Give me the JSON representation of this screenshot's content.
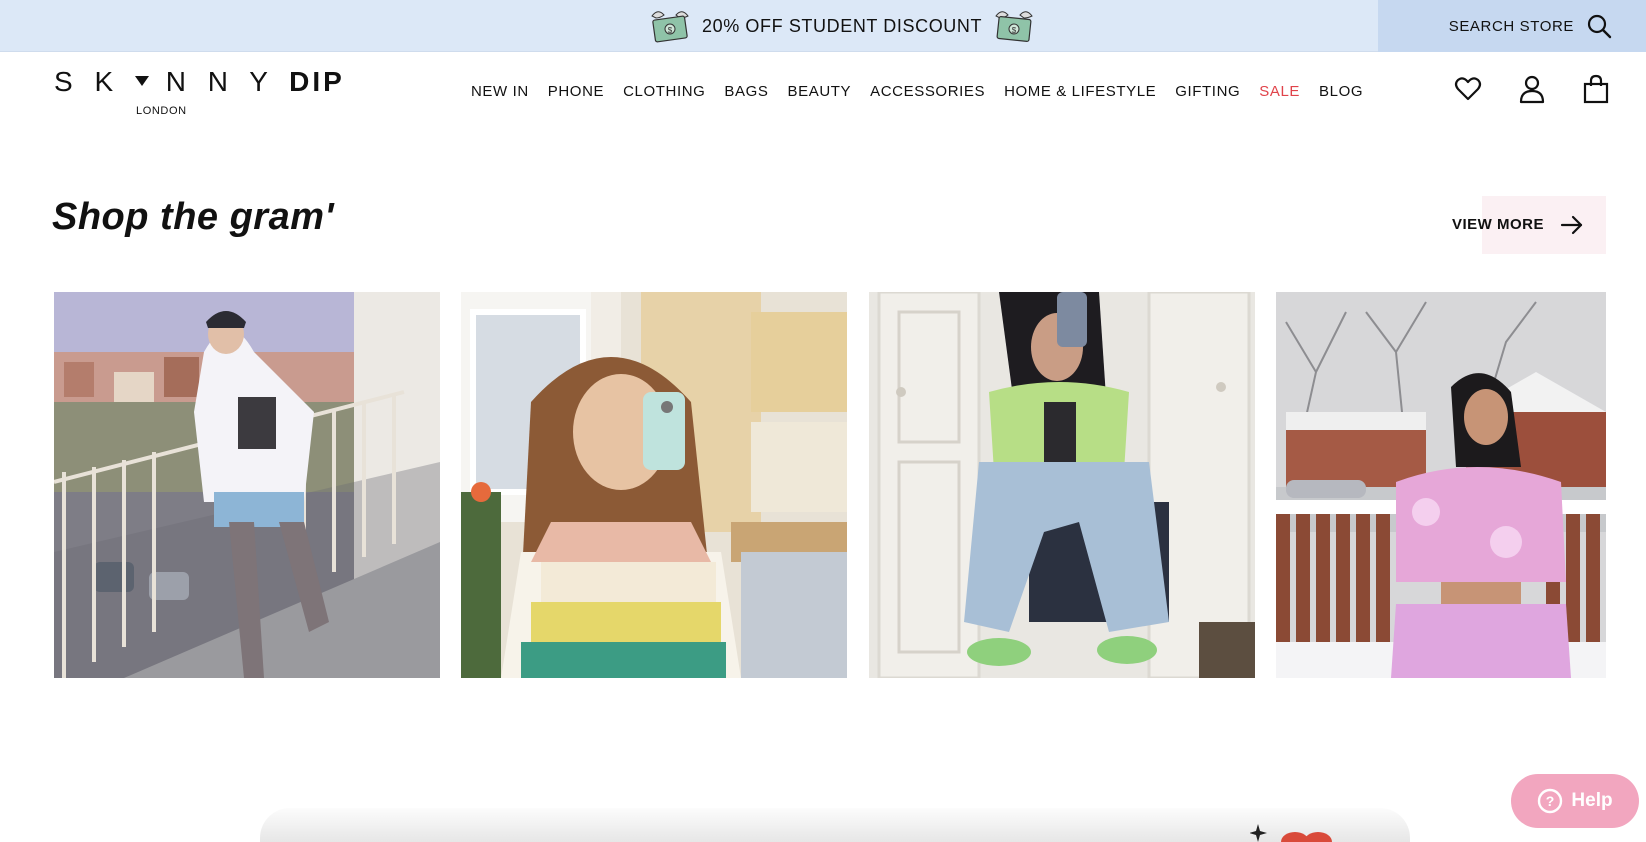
{
  "promo": {
    "text": "20% OFF STUDENT DISCOUNT",
    "icon": "money-with-wings-icon"
  },
  "search": {
    "label": "SEARCH STORE",
    "icon": "search-icon"
  },
  "logo": {
    "text": "SKYNNY DIP",
    "subtext": "LONDON"
  },
  "nav": {
    "items": [
      {
        "label": "NEW IN"
      },
      {
        "label": "PHONE"
      },
      {
        "label": "CLOTHING"
      },
      {
        "label": "BAGS"
      },
      {
        "label": "BEAUTY"
      },
      {
        "label": "ACCESSORIES"
      },
      {
        "label": "HOME & LIFESTYLE"
      },
      {
        "label": "GIFTING"
      },
      {
        "label": "SALE",
        "color": "#e0434a"
      },
      {
        "label": "BLOG"
      }
    ]
  },
  "header_icons": [
    "heart-icon",
    "account-icon",
    "bag-icon"
  ],
  "section": {
    "title": "Shop the gram'",
    "view_more": "VIEW MORE"
  },
  "gallery": {
    "photos": [
      {
        "subject": "person in hoodie and thigh-high boots on balcony"
      },
      {
        "subject": "selfie in striped knit vest"
      },
      {
        "subject": "mirror selfie seated in green top and jeans"
      },
      {
        "subject": "person in pink tie-dye set in snow"
      }
    ]
  },
  "help": {
    "label": "Help"
  },
  "colors": {
    "promo_bg": "#dce8f7",
    "search_bg": "#c6d8f0",
    "sale": "#e0434a",
    "view_more_bg": "#fbf0f3",
    "help_bg": "#f2a6bf"
  }
}
